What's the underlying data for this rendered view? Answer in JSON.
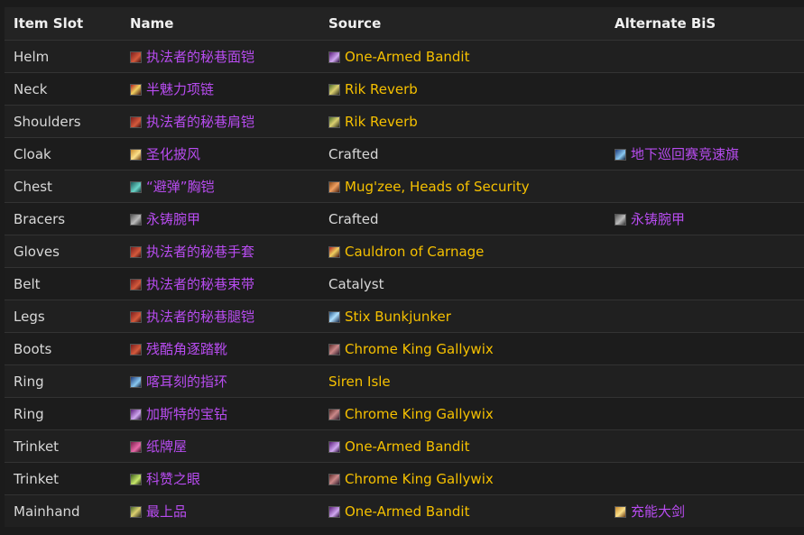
{
  "headers": {
    "slot": "Item Slot",
    "name": "Name",
    "source": "Source",
    "alt": "Alternate BiS"
  },
  "rows": [
    {
      "slot": "Helm",
      "name": "执法者的秘巷面铠",
      "name_icon": "helm-icon",
      "source": "One-Armed Bandit",
      "source_type": "boss",
      "source_icon": "boss-portrait-icon",
      "alt": "",
      "alt_icon": ""
    },
    {
      "slot": "Neck",
      "name": "半魅力项链",
      "name_icon": "neck-icon",
      "source": "Rik Reverb",
      "source_type": "boss",
      "source_icon": "boss-portrait-icon",
      "alt": "",
      "alt_icon": ""
    },
    {
      "slot": "Shoulders",
      "name": "执法者的秘巷肩铠",
      "name_icon": "shoulders-icon",
      "source": "Rik Reverb",
      "source_type": "boss",
      "source_icon": "boss-portrait-icon",
      "alt": "",
      "alt_icon": ""
    },
    {
      "slot": "Cloak",
      "name": "圣化披风",
      "name_icon": "cloak-icon",
      "source": "Crafted",
      "source_type": "plain",
      "source_icon": "",
      "alt": "地下巡回赛竞速旗",
      "alt_icon": "cloak-icon"
    },
    {
      "slot": "Chest",
      "name": "“避弹”胸铠",
      "name_icon": "chest-icon",
      "source": "Mug'zee, Heads of Security",
      "source_type": "boss",
      "source_icon": "boss-portrait-icon",
      "alt": "",
      "alt_icon": ""
    },
    {
      "slot": "Bracers",
      "name": "永铸腕甲",
      "name_icon": "bracers-icon",
      "source": "Crafted",
      "source_type": "plain",
      "source_icon": "",
      "alt": "永铸腕甲",
      "alt_icon": "bracers-icon"
    },
    {
      "slot": "Gloves",
      "name": "执法者的秘巷手套",
      "name_icon": "gloves-icon",
      "source": "Cauldron of Carnage",
      "source_type": "boss",
      "source_icon": "boss-portrait-icon",
      "alt": "",
      "alt_icon": ""
    },
    {
      "slot": "Belt",
      "name": "执法者的秘巷束带",
      "name_icon": "belt-icon",
      "source": "Catalyst",
      "source_type": "plain",
      "source_icon": "",
      "alt": "",
      "alt_icon": ""
    },
    {
      "slot": "Legs",
      "name": "执法者的秘巷腿铠",
      "name_icon": "legs-icon",
      "source": "Stix Bunkjunker",
      "source_type": "boss",
      "source_icon": "boss-portrait-icon",
      "alt": "",
      "alt_icon": ""
    },
    {
      "slot": "Boots",
      "name": "残酷角逐踏靴",
      "name_icon": "boots-icon",
      "source": "Chrome King Gallywix",
      "source_type": "boss",
      "source_icon": "boss-portrait-icon",
      "alt": "",
      "alt_icon": ""
    },
    {
      "slot": "Ring",
      "name": "喀耳刻的指环",
      "name_icon": "ring-icon",
      "source": "Siren Isle",
      "source_type": "zone",
      "source_icon": "",
      "alt": "",
      "alt_icon": ""
    },
    {
      "slot": "Ring",
      "name": "加斯特的宝钻",
      "name_icon": "ring-icon",
      "source": "Chrome King Gallywix",
      "source_type": "boss",
      "source_icon": "boss-portrait-icon",
      "alt": "",
      "alt_icon": ""
    },
    {
      "slot": "Trinket",
      "name": "纸牌屋",
      "name_icon": "trinket-icon",
      "source": "One-Armed Bandit",
      "source_type": "boss",
      "source_icon": "boss-portrait-icon",
      "alt": "",
      "alt_icon": ""
    },
    {
      "slot": "Trinket",
      "name": "科赞之眼",
      "name_icon": "trinket-icon",
      "source": "Chrome King Gallywix",
      "source_type": "boss",
      "source_icon": "boss-portrait-icon",
      "alt": "",
      "alt_icon": ""
    },
    {
      "slot": "Mainhand",
      "name": "最上品",
      "name_icon": "weapon-icon",
      "source": "One-Armed Bandit",
      "source_type": "boss",
      "source_icon": "boss-portrait-icon",
      "alt": "充能大剑",
      "alt_icon": "weapon-icon"
    }
  ],
  "colors": {
    "item_link": "#b84cf0",
    "source_link": "#f5c000",
    "text": "#d8d8d8",
    "header_text": "#f0f0f0",
    "background": "#1b1b1b"
  }
}
